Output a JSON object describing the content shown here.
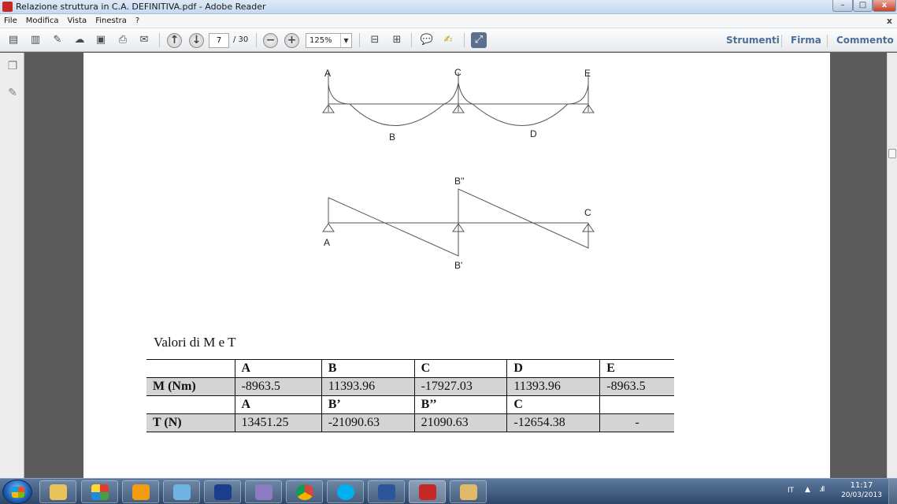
{
  "window": {
    "title": "Relazione struttura in C.A. DEFINITIVA.pdf - Adobe Reader",
    "min": "–",
    "max": "□",
    "close": "x"
  },
  "menu": {
    "items": [
      "File",
      "Modifica",
      "Vista",
      "Finestra",
      "?"
    ],
    "close": "x"
  },
  "toolbar": {
    "page_current": "7",
    "page_total": "/ 30",
    "zoom": "125%",
    "tools": "Strumenti",
    "sign": "Firma",
    "comment": "Commento",
    "zoom_out": "−",
    "zoom_in": "+"
  },
  "diagram_moment": {
    "labels": {
      "A": "A",
      "C": "C",
      "E": "E",
      "B": "B",
      "D": "D"
    }
  },
  "diagram_shear": {
    "labels": {
      "top": "B''",
      "right": "C",
      "left": "A",
      "bottom": "B'"
    }
  },
  "document": {
    "caption": "Valori di M e T",
    "table": {
      "header1": [
        "",
        "A",
        "B",
        "C",
        "D",
        "E"
      ],
      "row_m": [
        "M (Nm)",
        "-8963.5",
        "11393.96",
        "-17927.03",
        "11393.96",
        "-8963.5"
      ],
      "header2": [
        "",
        "A",
        "B’",
        "B’’",
        "C",
        ""
      ],
      "row_t": [
        "T (N)",
        "13451.25",
        "-21090.63",
        "21090.63",
        "-12654.38",
        "-"
      ]
    }
  },
  "taskbar": {
    "lang": "IT",
    "time": "11:17",
    "date": "20/03/2013"
  },
  "colors": {
    "toolbar_link": "#4b6f96",
    "table_shade": "#d4d4d4",
    "taskbar": "#2d4769"
  }
}
